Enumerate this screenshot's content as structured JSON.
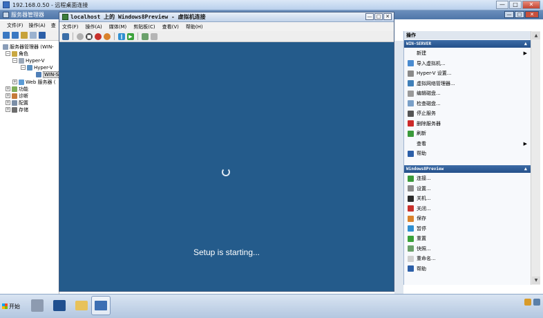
{
  "rdp": {
    "title": "192.168.0.50 - 远程桌面连接",
    "buttons": [
      "—",
      "□",
      "✕"
    ]
  },
  "server_manager": {
    "title": "服务器管理器",
    "menu": [
      "文件(F)",
      "操作(A)",
      "查"
    ],
    "tree": {
      "root": "服务器管理器 (WIN-",
      "roles": "角色",
      "hyperv": "Hyper-V",
      "hyperv_manager": "Hyper-V",
      "host": "WIN-S",
      "web": "Web 服务器 (",
      "features": "功能",
      "diagnostics": "诊断",
      "config": "配置",
      "storage": "存储"
    }
  },
  "vm_window": {
    "title": "localhost 上的 Windows8Preview - 虚拟机连接",
    "menu": [
      "文件(F)",
      "操作(A)",
      "媒体(M)",
      "剪贴板(C)",
      "查看(V)",
      "帮助(H)"
    ],
    "screen_text": "Setup is starting...",
    "screen_color": "#245b8b"
  },
  "actions": {
    "header": "操作",
    "server_section": "WIN-SERVER",
    "server_items": [
      {
        "label": "新建",
        "icon": "none-icon",
        "submenu": true
      },
      {
        "label": "导入虚拟机...",
        "icon": "import-icon"
      },
      {
        "label": "Hyper-V 设置...",
        "icon": "settings-icon"
      },
      {
        "label": "虚拟网络管理器...",
        "icon": "network-icon"
      },
      {
        "label": "编辑磁盘...",
        "icon": "edit-disk-icon"
      },
      {
        "label": "检查磁盘...",
        "icon": "inspect-disk-icon"
      },
      {
        "label": "停止服务",
        "icon": "stop-icon"
      },
      {
        "label": "删除服务器",
        "icon": "delete-icon"
      },
      {
        "label": "刷新",
        "icon": "refresh-icon"
      },
      {
        "label": "查看",
        "icon": "none-icon",
        "submenu": true
      },
      {
        "label": "帮助",
        "icon": "help-icon"
      }
    ],
    "vm_section": "Windows8Preview",
    "vm_items": [
      {
        "label": "连接...",
        "icon": "connect-icon"
      },
      {
        "label": "设置...",
        "icon": "settings-icon"
      },
      {
        "label": "关机...",
        "icon": "shutdown-icon"
      },
      {
        "label": "关闭...",
        "icon": "turnoff-icon"
      },
      {
        "label": "保存",
        "icon": "save-icon"
      },
      {
        "label": "暂停",
        "icon": "pause-icon"
      },
      {
        "label": "重置",
        "icon": "reset-icon"
      },
      {
        "label": "快照...",
        "icon": "snapshot-icon"
      },
      {
        "label": "重命名...",
        "icon": "rename-icon"
      },
      {
        "label": "帮助",
        "icon": "help-icon"
      }
    ]
  },
  "taskbar": {
    "start_label": "开始"
  }
}
